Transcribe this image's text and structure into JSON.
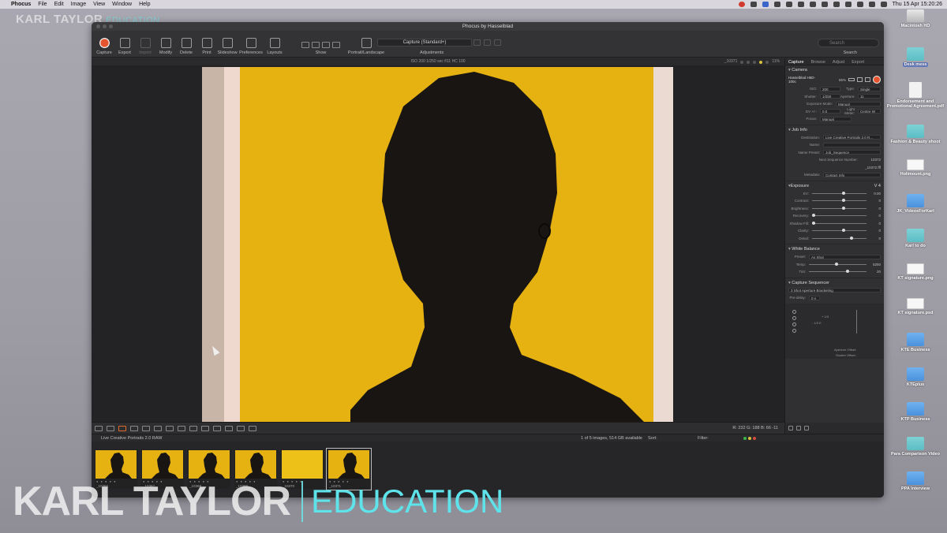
{
  "menubar": {
    "app": "Phocus",
    "items": [
      "File",
      "Edit",
      "Image",
      "View",
      "Window",
      "Help"
    ],
    "clock": "Thu 15 Apr  15:20:26"
  },
  "watermark": {
    "top_name": "KARL TAYLOR",
    "top_edu": "EDUCATION",
    "big_name": "KARL TAYLOR",
    "big_edu": "EDUCATION"
  },
  "window": {
    "title": "Phocus by Hasselblad"
  },
  "toolbar": {
    "items": [
      {
        "label": "Capture",
        "icon": "record-icon"
      },
      {
        "label": "Export",
        "icon": "export-icon"
      },
      {
        "label": "Import",
        "icon": "import-icon"
      },
      {
        "label": "Modify",
        "icon": "modify-icon"
      },
      {
        "label": "Delete",
        "icon": "trash-icon"
      },
      {
        "label": "Print",
        "icon": "printer-icon"
      },
      {
        "label": "Slideshow",
        "icon": "slideshow-icon"
      },
      {
        "label": "Preferences",
        "icon": "preferences-icon"
      },
      {
        "label": "Layouts",
        "icon": "layouts-icon"
      }
    ],
    "show_label": "Show",
    "portrait_label": "Portrait/Landscape",
    "preset_value": "Capture (Standard+)",
    "adjustments_label": "Adjustments",
    "search_placeholder": "Search",
    "search_label": "Search"
  },
  "infobar": {
    "text": "ISO 200  1/250 sec  f/11  HC 100",
    "image_name": "_10371",
    "zoom": "11%"
  },
  "bottom_tools": {
    "rgb": "R: 232  G: 188  B:  66  -11"
  },
  "browser": {
    "folder": "Live Creative Portraits 2.0 RAW",
    "count": "1 of 5 images, 514 GB available",
    "sort_label": "Sort:",
    "filter_label": "Filter:"
  },
  "thumbnails": [
    {
      "num": "_10366"
    },
    {
      "num": "_10367"
    },
    {
      "num": "_10368"
    },
    {
      "num": "_10369"
    },
    {
      "num": "_10370"
    },
    {
      "num": "_10371"
    }
  ],
  "panel": {
    "tabs": [
      "Capture",
      "Browse",
      "Adjust",
      "Export"
    ],
    "camera": {
      "title": "Camera",
      "model": "Hasselblad H6D-100c",
      "battery": "85%",
      "iso_label": "ISO:",
      "iso": "200",
      "type_label": "Type:",
      "type": "Single",
      "shutter_label": "Shutter:",
      "shutter": "1/250",
      "aperture_label": "Aperture:",
      "aperture": "11",
      "exposure_mode_label": "Exposure Mode:",
      "exposure_mode": "Manual",
      "ev_label": "EV +/-:",
      "ev": "0.0",
      "light_meter_label": "Light Meter:",
      "light_meter": "Centre W",
      "focus_label": "Focus:",
      "focus": "Manual"
    },
    "job": {
      "title": "Job Info",
      "destination_label": "Destination:",
      "destination": "Live Creative Portraits 2.0 R...",
      "name_label": "Name:",
      "name": "",
      "name_preset_label": "Name Preset:",
      "name_preset": "Job_Sequence",
      "next_seq_label": "Next Sequence Number:",
      "next_seq": "10372",
      "next_file": "_10372.fff",
      "metadata_label": "Metadata:",
      "metadata": "Contact Info"
    },
    "exposure": {
      "title": "Exposure",
      "version": "V 4",
      "rows": [
        {
          "label": "EV:",
          "value": "0.00",
          "pos": 0.55
        },
        {
          "label": "Contrast:",
          "value": "0",
          "pos": 0.55
        },
        {
          "label": "Brightness:",
          "value": "0",
          "pos": 0.55
        },
        {
          "label": "Recovery:",
          "value": "0",
          "pos": 0.0
        },
        {
          "label": "Shadow Fill:",
          "value": "0",
          "pos": 0.0
        },
        {
          "label": "Clarity:",
          "value": "0",
          "pos": 0.55
        },
        {
          "label": "Detail:",
          "value": "0",
          "pos": 0.7
        }
      ]
    },
    "white_balance": {
      "title": "White Balance",
      "preset_label": "Preset:",
      "preset": "As Shot",
      "temp_label": "Temp:",
      "temp": "5250",
      "temp_pos": 0.45,
      "tint_label": "Tint:",
      "tint": "20",
      "tint_pos": 0.65
    },
    "sequencer": {
      "title": "Capture Sequencer",
      "mode": "3 Shot Aperture Bracketing",
      "predelay_label": "Pre-delay:",
      "predelay": "0 s",
      "plus_label": "+ 1/3",
      "minus_label": "- 1/3 E",
      "aperture_offset": "Aperture Offset:",
      "shutter_offset": "Shutter Offset:"
    }
  },
  "desktop": [
    {
      "label": "Macintosh HD",
      "kind": "hd"
    },
    {
      "label": "Desk mess",
      "kind": "folder",
      "selected": true
    },
    {
      "label": "Endorsement and Promotional Agreement.pdf",
      "kind": "file"
    },
    {
      "label": "Fashion & Beauty shoot",
      "kind": "folder"
    },
    {
      "label": "Holimount.png",
      "kind": "image"
    },
    {
      "label": "JK_VideosForKarl",
      "kind": "folder-blue"
    },
    {
      "label": "Karl to do",
      "kind": "folder"
    },
    {
      "label": "KT signature.png",
      "kind": "image"
    },
    {
      "label": "KT signature.psd",
      "kind": "image"
    },
    {
      "label": "KTE Business",
      "kind": "folder-blue"
    },
    {
      "label": "KTEplus",
      "kind": "folder-blue"
    },
    {
      "label": "KTP Business",
      "kind": "folder-blue"
    },
    {
      "label": "Para Comparison Video",
      "kind": "folder"
    },
    {
      "label": "PPA Interview",
      "kind": "folder-blue"
    }
  ]
}
